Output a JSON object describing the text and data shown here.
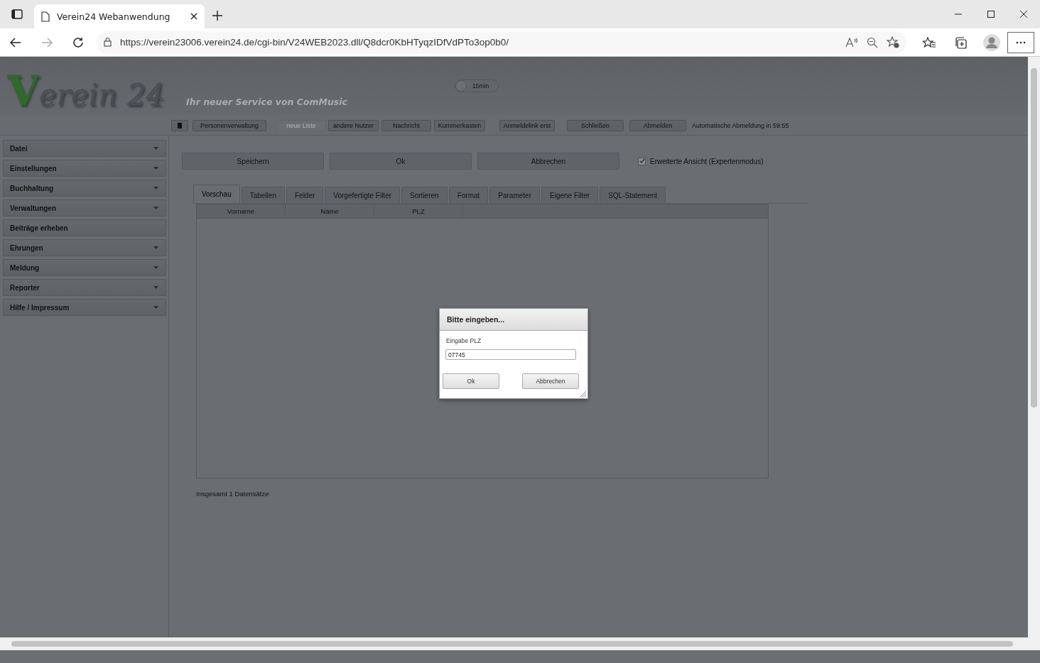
{
  "browser": {
    "tab_title": "Verein24 Webanwendung",
    "url": "https://verein23006.verein24.de/cgi-bin/V24WEB2023.dll/Q8dcr0KbHTyqzIDfVdPTo3op0b0/"
  },
  "header": {
    "logo": "Verein 24",
    "slogan": "Ihr neuer Service von ComMusic",
    "toggle": {
      "label": "15min",
      "on": false
    }
  },
  "toolbar": {
    "buttons": [
      {
        "label": "Personenverwaltung",
        "disabled": false
      },
      {
        "label": "neue Liste",
        "disabled": true
      },
      {
        "label": "andere Nutzer",
        "disabled": false
      },
      {
        "label": "Nachricht",
        "disabled": false
      },
      {
        "label": "Kummerkasten",
        "disabled": false
      },
      {
        "label": "Anmeldelink erst",
        "disabled": false
      },
      {
        "label": "Schließen",
        "disabled": false
      },
      {
        "label": "Abmelden",
        "disabled": false
      }
    ],
    "auto_logout": "Automatische Abmeldung in 59:55"
  },
  "sidebar": {
    "items": [
      {
        "label": "Datei",
        "dropdown": true
      },
      {
        "label": "Einstellungen",
        "dropdown": true
      },
      {
        "label": "Buchhaltung",
        "dropdown": true
      },
      {
        "label": "Verwaltungen",
        "dropdown": true
      },
      {
        "label": "Beiträge erheben",
        "dropdown": false
      },
      {
        "label": "Ehrungen",
        "dropdown": true
      },
      {
        "label": "Meldung",
        "dropdown": true
      },
      {
        "label": "Reporter",
        "dropdown": true
      },
      {
        "label": "Hilfe / Impressum",
        "dropdown": true
      }
    ]
  },
  "actions": [
    "Speichern",
    "Ok",
    "Abbrechen"
  ],
  "expert_mode": {
    "label": "Erweiterte Ansicht (Expertenmodus)",
    "checked": true
  },
  "tabs": [
    {
      "label": "Vorschau",
      "selected": true
    },
    {
      "label": "Tabellen",
      "selected": false
    },
    {
      "label": "Felder",
      "selected": false
    },
    {
      "label": "Vorgefertigte Filter",
      "selected": false
    },
    {
      "label": "Sortieren",
      "selected": false
    },
    {
      "label": "Format",
      "selected": false
    },
    {
      "label": "Parameter",
      "selected": false
    },
    {
      "label": "Eigene Filter",
      "selected": false
    },
    {
      "label": "SQL-Statement",
      "selected": false
    }
  ],
  "table": {
    "columns": [
      "Vorname",
      "Name",
      "PLZ"
    ]
  },
  "footer": "Insgesamt 1 Datensätze",
  "dialog": {
    "title": "Bitte eingeben...",
    "label": "Eingabe PLZ",
    "value": "07745",
    "buttons": [
      "Ok",
      "Abbrechen"
    ]
  }
}
